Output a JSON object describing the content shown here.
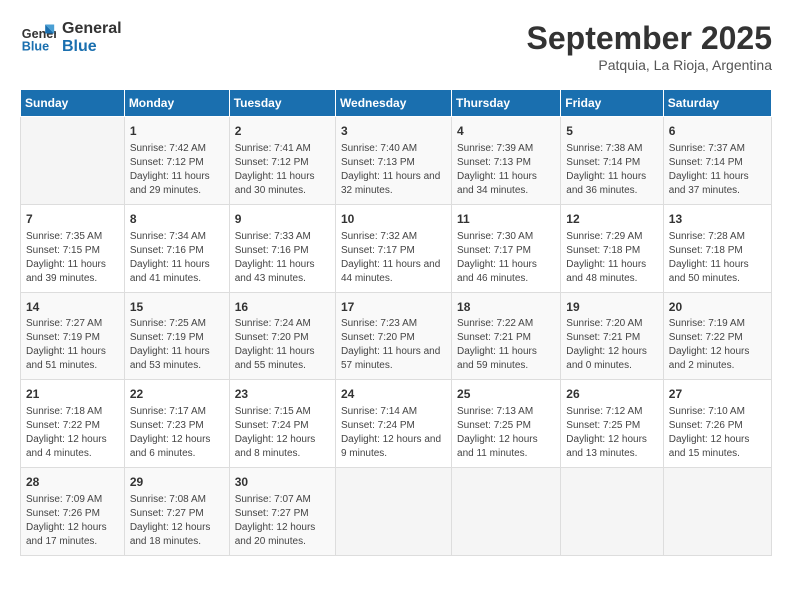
{
  "header": {
    "logo_line1": "General",
    "logo_line2": "Blue",
    "month": "September 2025",
    "location": "Patquia, La Rioja, Argentina"
  },
  "days_of_week": [
    "Sunday",
    "Monday",
    "Tuesday",
    "Wednesday",
    "Thursday",
    "Friday",
    "Saturday"
  ],
  "weeks": [
    [
      {
        "num": "",
        "empty": true
      },
      {
        "num": "1",
        "rise": "7:42 AM",
        "set": "7:12 PM",
        "daylight": "11 hours and 29 minutes."
      },
      {
        "num": "2",
        "rise": "7:41 AM",
        "set": "7:12 PM",
        "daylight": "11 hours and 30 minutes."
      },
      {
        "num": "3",
        "rise": "7:40 AM",
        "set": "7:13 PM",
        "daylight": "11 hours and 32 minutes."
      },
      {
        "num": "4",
        "rise": "7:39 AM",
        "set": "7:13 PM",
        "daylight": "11 hours and 34 minutes."
      },
      {
        "num": "5",
        "rise": "7:38 AM",
        "set": "7:14 PM",
        "daylight": "11 hours and 36 minutes."
      },
      {
        "num": "6",
        "rise": "7:37 AM",
        "set": "7:14 PM",
        "daylight": "11 hours and 37 minutes."
      }
    ],
    [
      {
        "num": "7",
        "rise": "7:35 AM",
        "set": "7:15 PM",
        "daylight": "11 hours and 39 minutes."
      },
      {
        "num": "8",
        "rise": "7:34 AM",
        "set": "7:16 PM",
        "daylight": "11 hours and 41 minutes."
      },
      {
        "num": "9",
        "rise": "7:33 AM",
        "set": "7:16 PM",
        "daylight": "11 hours and 43 minutes."
      },
      {
        "num": "10",
        "rise": "7:32 AM",
        "set": "7:17 PM",
        "daylight": "11 hours and 44 minutes."
      },
      {
        "num": "11",
        "rise": "7:30 AM",
        "set": "7:17 PM",
        "daylight": "11 hours and 46 minutes."
      },
      {
        "num": "12",
        "rise": "7:29 AM",
        "set": "7:18 PM",
        "daylight": "11 hours and 48 minutes."
      },
      {
        "num": "13",
        "rise": "7:28 AM",
        "set": "7:18 PM",
        "daylight": "11 hours and 50 minutes."
      }
    ],
    [
      {
        "num": "14",
        "rise": "7:27 AM",
        "set": "7:19 PM",
        "daylight": "11 hours and 51 minutes."
      },
      {
        "num": "15",
        "rise": "7:25 AM",
        "set": "7:19 PM",
        "daylight": "11 hours and 53 minutes."
      },
      {
        "num": "16",
        "rise": "7:24 AM",
        "set": "7:20 PM",
        "daylight": "11 hours and 55 minutes."
      },
      {
        "num": "17",
        "rise": "7:23 AM",
        "set": "7:20 PM",
        "daylight": "11 hours and 57 minutes."
      },
      {
        "num": "18",
        "rise": "7:22 AM",
        "set": "7:21 PM",
        "daylight": "11 hours and 59 minutes."
      },
      {
        "num": "19",
        "rise": "7:20 AM",
        "set": "7:21 PM",
        "daylight": "12 hours and 0 minutes."
      },
      {
        "num": "20",
        "rise": "7:19 AM",
        "set": "7:22 PM",
        "daylight": "12 hours and 2 minutes."
      }
    ],
    [
      {
        "num": "21",
        "rise": "7:18 AM",
        "set": "7:22 PM",
        "daylight": "12 hours and 4 minutes."
      },
      {
        "num": "22",
        "rise": "7:17 AM",
        "set": "7:23 PM",
        "daylight": "12 hours and 6 minutes."
      },
      {
        "num": "23",
        "rise": "7:15 AM",
        "set": "7:24 PM",
        "daylight": "12 hours and 8 minutes."
      },
      {
        "num": "24",
        "rise": "7:14 AM",
        "set": "7:24 PM",
        "daylight": "12 hours and 9 minutes."
      },
      {
        "num": "25",
        "rise": "7:13 AM",
        "set": "7:25 PM",
        "daylight": "12 hours and 11 minutes."
      },
      {
        "num": "26",
        "rise": "7:12 AM",
        "set": "7:25 PM",
        "daylight": "12 hours and 13 minutes."
      },
      {
        "num": "27",
        "rise": "7:10 AM",
        "set": "7:26 PM",
        "daylight": "12 hours and 15 minutes."
      }
    ],
    [
      {
        "num": "28",
        "rise": "7:09 AM",
        "set": "7:26 PM",
        "daylight": "12 hours and 17 minutes."
      },
      {
        "num": "29",
        "rise": "7:08 AM",
        "set": "7:27 PM",
        "daylight": "12 hours and 18 minutes."
      },
      {
        "num": "30",
        "rise": "7:07 AM",
        "set": "7:27 PM",
        "daylight": "12 hours and 20 minutes."
      },
      {
        "num": "",
        "empty": true
      },
      {
        "num": "",
        "empty": true
      },
      {
        "num": "",
        "empty": true
      },
      {
        "num": "",
        "empty": true
      }
    ]
  ]
}
